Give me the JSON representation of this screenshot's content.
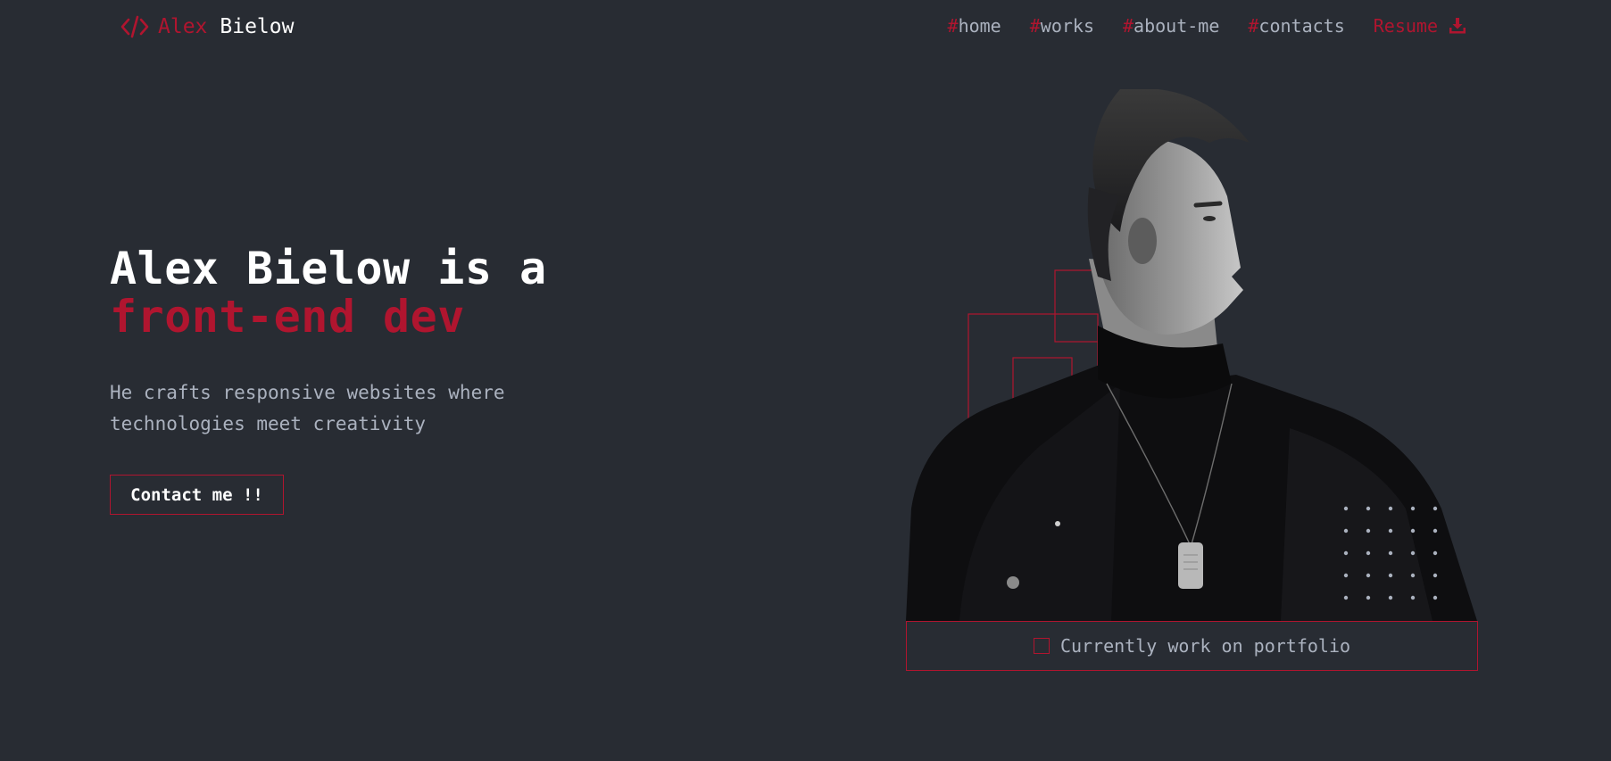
{
  "header": {
    "logo_icon": "code-brackets-icon",
    "logo_first": "Alex",
    "logo_last": "Bielow",
    "nav": [
      {
        "hash": "#",
        "label": "home"
      },
      {
        "hash": "#",
        "label": "works"
      },
      {
        "hash": "#",
        "label": "about-me"
      },
      {
        "hash": "#",
        "label": "contacts"
      }
    ],
    "resume_label": "Resume",
    "resume_icon": "download-icon"
  },
  "hero": {
    "title_line1": "Alex Bielow is a",
    "title_accent": "front-end dev",
    "description": "He crafts responsive websites where technologies meet creativity",
    "cta_label": "Contact me !!"
  },
  "status": {
    "icon": "square-outline-icon",
    "label": "Currently work on portfolio"
  },
  "colors": {
    "background": "#282c33",
    "accent": "#b0152f",
    "text": "#abb2bf",
    "heading": "#ffffff"
  }
}
